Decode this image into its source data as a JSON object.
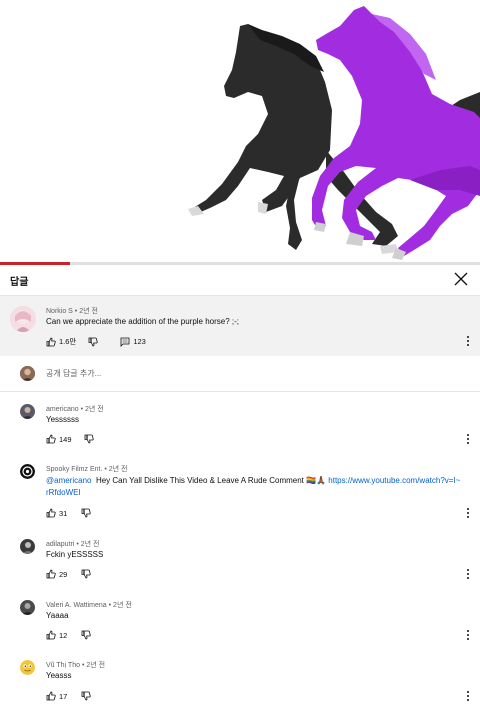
{
  "panel": {
    "title": "답글"
  },
  "video": {
    "progress_fraction": 0.145
  },
  "parent_comment": {
    "author": "Norkio S",
    "age": "2년 전",
    "text": "Can we appreciate the addition of the purple horse? ;-;",
    "likes": "1.6만",
    "replies": "123"
  },
  "reply_box": {
    "placeholder": "공개 답글 추가..."
  },
  "comments": [
    {
      "author": "americano",
      "age": "2년 전",
      "text": "Yessssss",
      "likes": "149"
    },
    {
      "author": "Spooky Filmz Ent.",
      "age": "2년 전",
      "mention": "@americano",
      "text": "Hey Can Yall Dislike This Video & Leave A Rude Comment 🏳️‍🌈🙏🏾",
      "link_part1": "https://www.youtube.com/watch?v=I~",
      "link_part2": "rRfdoWEI",
      "likes": "31"
    },
    {
      "author": "adilaputri",
      "age": "2년 전",
      "text": "Fckin yESSSSS",
      "likes": "29"
    },
    {
      "author": "Valeri A. Wattimena",
      "age": "2년 전",
      "text": "Yaaaa",
      "likes": "12"
    },
    {
      "author": "Vũ Thị Tho",
      "age": "2년 전",
      "text": "Yeasss",
      "likes": "17"
    }
  ],
  "colors": {
    "progress": "#c8232b",
    "link": "#065fd4",
    "purple_horse": "#a12ce0",
    "black_horse": "#2a2a2a"
  }
}
